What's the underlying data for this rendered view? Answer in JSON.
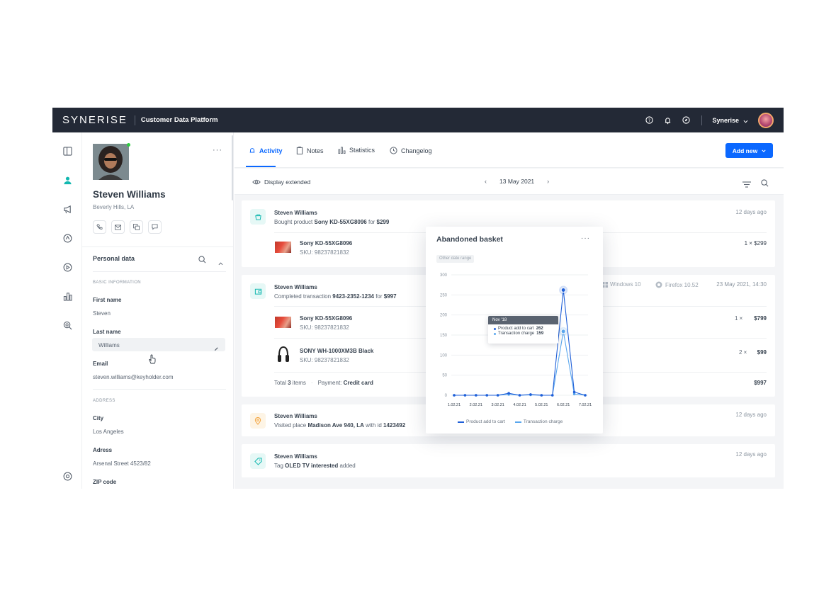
{
  "topbar": {
    "logo": "SYNERISE",
    "platform": "Customer Data Platform",
    "org": "Synerise"
  },
  "profile": {
    "name": "Steven Williams",
    "location": "Beverly Hills, LA",
    "personal_title": "Personal data",
    "basic_header": "BASIC INFORMATION",
    "first_name_label": "First name",
    "first_name": "Steven",
    "last_name_label": "Last name",
    "last_name": "Williams",
    "email_label": "Email",
    "email": "steven.williams@keyholder.com",
    "address_header": "ADDRESS",
    "city_label": "City",
    "city": "Los Angeles",
    "address_label": "Adress",
    "address": "Arsenal Street 4523/82",
    "zip_label": "ZIP code"
  },
  "tabs": {
    "activity": "Activity",
    "notes": "Notes",
    "statistics": "Statistics",
    "changelog": "Changelog"
  },
  "add_new": "Add new",
  "subbar": {
    "display_extended": "Display extended",
    "date": "13 May 2021"
  },
  "events": [
    {
      "name": "Steven Williams",
      "desc_pre": "Bought product ",
      "desc_bold": "Sony KD-55XG8096",
      "desc_mid": " for ",
      "desc_bold2": "$299",
      "time": "12 days ago",
      "product": "Sony KD-55XG8096",
      "sku": "SKU: 98237821832",
      "qty": "1 × $299"
    },
    {
      "name": "Steven Williams",
      "desc_pre": "Completed transaction ",
      "desc_bold": "9423-2352-1234",
      "desc_mid": " for ",
      "desc_bold2": "$997",
      "os": "Windows 10",
      "browser": "Firefox 10.52",
      "time": "23 May 2021, 14:30",
      "p1": "Sony KD-55XG8096",
      "p1_sku": "SKU: 98237821832",
      "p1_qty": "1 ×",
      "p1_price": "$799",
      "p2": "SONY WH-1000XM3B Black",
      "p2_sku": "SKU: 98237821832",
      "p2_qty": "2 ×",
      "p2_price": "$99",
      "total_pre": "Total ",
      "total_num": "3",
      "total_post": " items",
      "payment_pre": "Payment: ",
      "payment": "Credit card",
      "total_price": "$997"
    },
    {
      "name": "Steven Williams",
      "desc_pre": "Visited place ",
      "desc_bold": "Madison Ave 940, LA",
      "desc_mid": " with id ",
      "desc_bold2": "1423492",
      "time": "12 days ago"
    },
    {
      "name": "Steven Williams",
      "desc_pre": "Tag ",
      "desc_bold": "OLED TV interested",
      "desc_mid": " added",
      "time": "12 days ago"
    }
  ],
  "popup": {
    "title": "Abandoned basket",
    "chip": "Other date range",
    "tooltip_title": "Nov '18",
    "tooltip_rows": [
      {
        "label": "Product add to cart",
        "value": "262",
        "color": "#1f5fd8"
      },
      {
        "label": "Transaction charge",
        "value": "159",
        "color": "#5aa7ee"
      }
    ]
  },
  "chart_data": {
    "type": "line",
    "categories": [
      "1.02.21",
      "",
      "2.02.21",
      "",
      "3.02.21",
      "",
      "4.02.21",
      "",
      "5.02.21",
      "",
      "6.02.21",
      "",
      "7.02.21"
    ],
    "x_tick_labels": [
      "1.02.21",
      "2.02.21",
      "3.02.21",
      "4.02.21",
      "5.02.21",
      "6.02.21",
      "7.02.21"
    ],
    "y_ticks": [
      "0",
      "50",
      "100",
      "150",
      "200",
      "250",
      "300"
    ],
    "ylim": [
      0,
      300
    ],
    "series": [
      {
        "name": "Product add to cart",
        "color": "#1f5fd8",
        "values": [
          0,
          0,
          0,
          0,
          0,
          5,
          0,
          2,
          0,
          0,
          262,
          8,
          0
        ]
      },
      {
        "name": "Transaction charge",
        "color": "#5aa7ee",
        "values": [
          0,
          0,
          0,
          0,
          0,
          2,
          0,
          1,
          0,
          0,
          159,
          3,
          0
        ]
      }
    ]
  }
}
